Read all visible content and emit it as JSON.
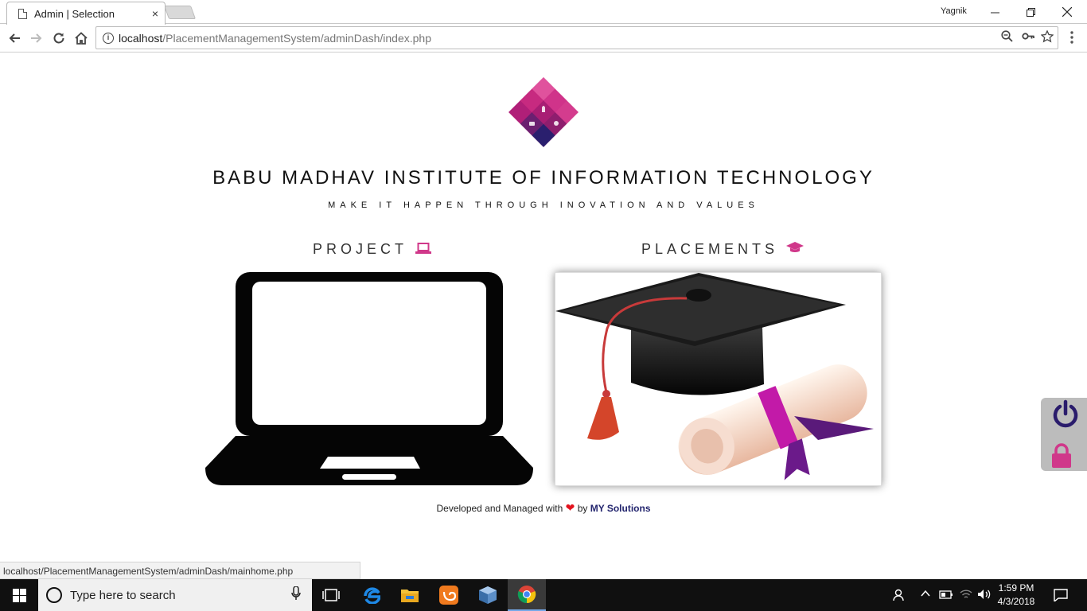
{
  "browser": {
    "tab_title": "Admin | Selection",
    "tab_close": "×",
    "user_name": "Yagnik",
    "url_host": "localhost",
    "url_path": "/PlacementManagementSystem/adminDash/index.php",
    "status_url": "localhost/PlacementManagementSystem/adminDash/mainhome.php"
  },
  "page": {
    "institute": "BABU MADHAV INSTITUTE OF INFORMATION TECHNOLOGY",
    "tagline": "MAKE IT HAPPEN THROUGH INOVATION AND VALUES",
    "project_label": "PROJECT",
    "placements_label": "PLACEMENTS",
    "footer_prefix": "Developed and Managed with",
    "footer_by": "by",
    "footer_brand": "MY Solutions",
    "accent_color": "#d0388a",
    "brand_color": "#23256e"
  },
  "taskbar": {
    "search_placeholder": "Type here to search",
    "time": "1:59 PM",
    "date": "4/3/2018"
  },
  "icons": {
    "project": "laptop-icon",
    "placements": "graduation-cap-icon",
    "side_top": "power-icon",
    "side_bottom": "lock-icon"
  }
}
